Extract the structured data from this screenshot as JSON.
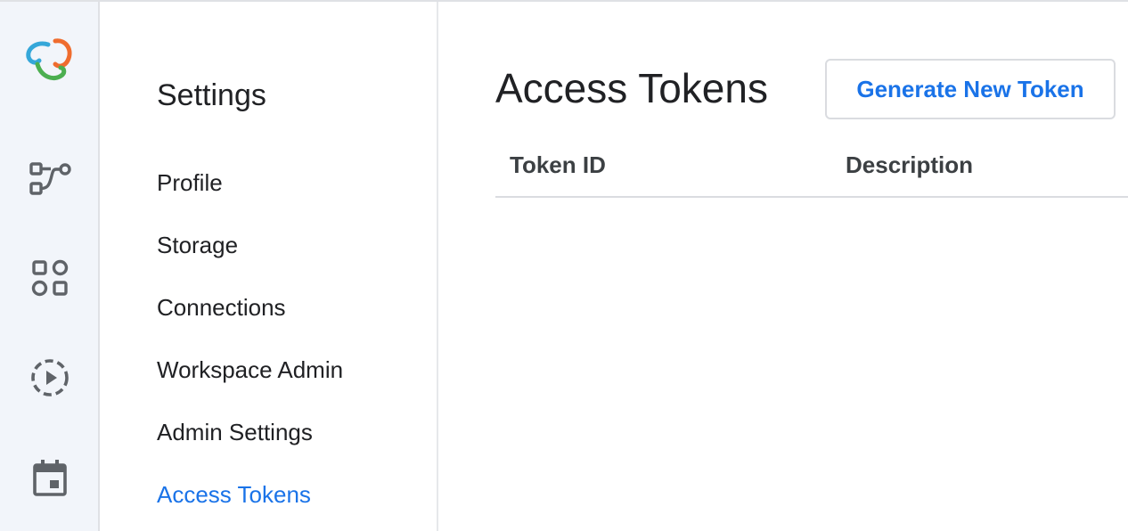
{
  "colors": {
    "accent": "#1a73e8",
    "rail_bg": "#f2f5fa",
    "text": "#202124",
    "icon": "#5f6368",
    "logo": [
      "#ef6c2e",
      "#35a7d9",
      "#4caf50"
    ]
  },
  "rail": {
    "logo_icon": "app-logo",
    "items": [
      {
        "icon": "workflow-icon"
      },
      {
        "icon": "apps-grid-icon"
      },
      {
        "icon": "runs-play-icon"
      },
      {
        "icon": "calendar-icon"
      }
    ]
  },
  "settings": {
    "title": "Settings",
    "items": [
      {
        "label": "Profile"
      },
      {
        "label": "Storage"
      },
      {
        "label": "Connections"
      },
      {
        "label": "Workspace Admin"
      },
      {
        "label": "Admin Settings"
      },
      {
        "label": "Access Tokens",
        "active": true
      }
    ]
  },
  "main": {
    "title": "Access Tokens",
    "generate_button": "Generate New Token",
    "table": {
      "columns": [
        "Token ID",
        "Description"
      ],
      "rows": []
    }
  }
}
